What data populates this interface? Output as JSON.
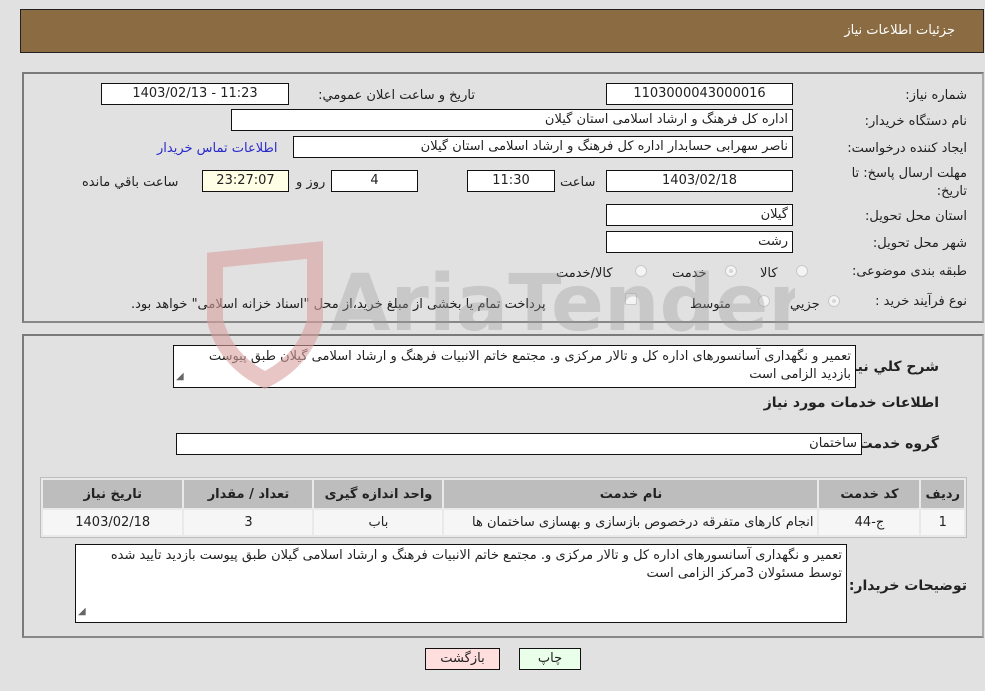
{
  "header": {
    "title": "جزئیات اطلاعات نیاز"
  },
  "form": {
    "need_number": {
      "label": "شماره نیاز:",
      "value": "1103000043000016"
    },
    "announce": {
      "label": "تاریخ و ساعت اعلان عمومي:",
      "value": "1403/02/13 - 11:23"
    },
    "buyer_org": {
      "label": "نام دستگاه خریدار:",
      "value": "اداره کل فرهنگ و ارشاد اسلامی استان گیلان"
    },
    "requester": {
      "label": "ایجاد کننده درخواست:",
      "value": "ناصر سهرابی حسابدار اداره کل فرهنگ و ارشاد اسلامی استان گیلان"
    },
    "contact_link": "اطلاعات تماس خریدار",
    "deadline": {
      "label": "مهلت ارسال پاسخ: تا تاریخ:",
      "date": "1403/02/18",
      "time_label": "ساعت",
      "time": "11:30",
      "days": "4",
      "days_label": "روز و",
      "remaining": "23:27:07",
      "remaining_label": "ساعت باقي مانده"
    },
    "province": {
      "label": "استان محل تحویل:",
      "value": "گیلان"
    },
    "city": {
      "label": "شهر محل تحویل:",
      "value": "رشت"
    },
    "category": {
      "label": "طبقه بندی موضوعی:",
      "options": [
        "کالا",
        "خدمت",
        "کالا/خدمت"
      ],
      "selected": "خدمت"
    },
    "process": {
      "label": "نوع فرآیند خرید :",
      "options": [
        "جزيي",
        "متوسط"
      ],
      "selected": "جزيي",
      "treasury_note": "پرداخت تمام یا بخشی از مبلغ خرید،از محل \"اسناد خزانه اسلامی\" خواهد بود."
    }
  },
  "details": {
    "summary_label": "شرح کلي نياز:",
    "summary": "تعمیر و نگهداری آسانسورهای اداره کل و تالار مرکزی و. مجتمع خاتم الانبیات فرهنگ و ارشاد اسلامی گیلان طبق پیوست بازدید الزامی است",
    "services_heading": "اطلاعات خدمات مورد نیاز",
    "service_group_label": "گروه خدمت:",
    "service_group": "ساختمان",
    "table": {
      "headers": [
        "ردیف",
        "کد خدمت",
        "نام خدمت",
        "واحد اندازه گیری",
        "تعداد / مقدار",
        "تاریخ نیاز"
      ],
      "rows": [
        [
          "1",
          "ج-44",
          "انجام کارهای متفرقه درخصوص بازسازی و بهسازی ساختمان ها",
          "باب",
          "3",
          "1403/02/18"
        ]
      ]
    },
    "buyer_notes_label": "توضیحات خریدار:",
    "buyer_notes": "تعمیر و نگهداری آسانسورهای اداره کل و تالار مرکزی و. مجتمع خاتم الانبیات فرهنگ و ارشاد اسلامی گیلان طبق پیوست بازدید تایید شده توسط مسئولان 3مرکز  الزامی است"
  },
  "buttons": {
    "print": "چاپ",
    "back": "بازگشت"
  },
  "watermark": {
    "text": "AriaTender.neT"
  },
  "colors": {
    "header_bg": "#8b6c42",
    "print_bg": "#eaffea",
    "back_bg": "#ffdede",
    "link": "#2a2acb"
  }
}
